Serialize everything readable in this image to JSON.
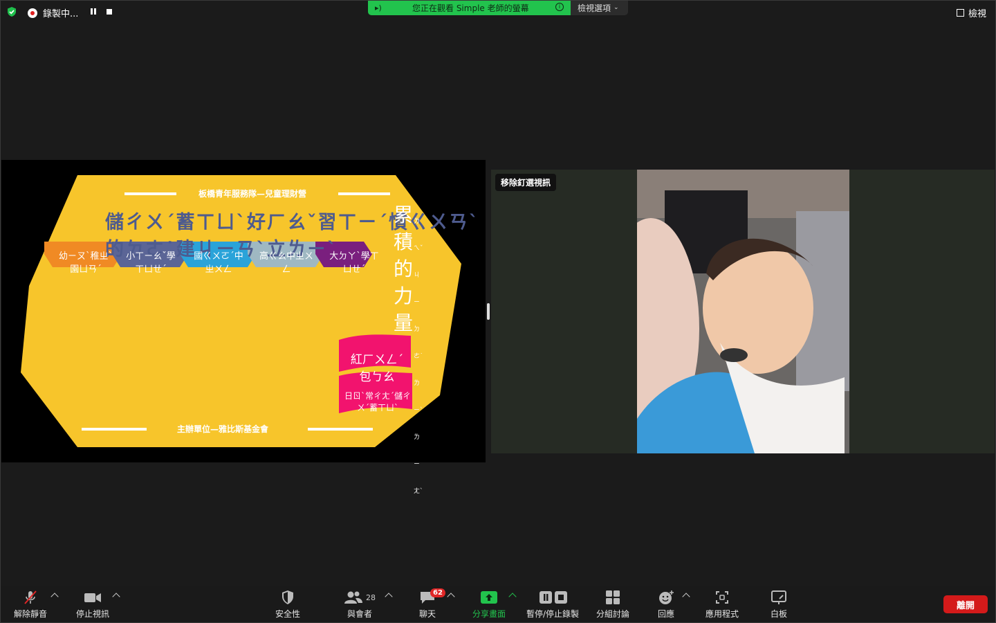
{
  "topbar": {
    "recording_label": "錄製中...",
    "share_banner": "您正在觀看 Simple 老師的螢幕",
    "view_options": "檢視選項",
    "view_label": "檢視"
  },
  "slide": {
    "top_caption": "板橋青年服務隊—兒童理財營",
    "title": "儲ㄔㄨˊ蓄ㄒㄩˋ好ㄏㄠˇ習ㄒㄧˊ慣ㄍㄨㄢˋ的ㄉㄜ˙建ㄐㄧㄢˋ立ㄌㄧˋ",
    "stages": [
      "幼ㄧㄡˋ稚ㄓˋ園ㄩㄢˊ",
      "小ㄒㄧㄠˇ學ㄒㄩㄝˊ",
      "國ㄍㄨㄛˊ中ㄓㄨㄥ",
      "高ㄍㄠ中ㄓㄨㄥ",
      "大ㄉㄚˋ學ㄒㄩㄝˊ"
    ],
    "stage_colors": [
      "#f08a24",
      "#5b6596",
      "#2aa3d9",
      "#9fb8c2",
      "#7a1f7e"
    ],
    "vertical_title": [
      "累",
      "積",
      "的",
      "力",
      "量"
    ],
    "vertical_zhuyin": [
      "ㄌㄟˇ",
      "ㄐㄧ",
      "ㄉㄜ˙",
      "ㄌㄧˋ",
      "ㄌㄧㄤˋ"
    ],
    "flag1": "紅ㄏㄨㄥˊ包ㄅㄠ",
    "flag2": "日ㄖˋ常ㄔㄤˊ儲ㄔㄨˊ蓄ㄒㄩˋ",
    "bottom_caption": "主辦單位—雅比斯基金會",
    "bg_color": "#f7c52b"
  },
  "video": {
    "unpin_label": "移除釘選視訊"
  },
  "toolbar": {
    "unmute": "解除靜音",
    "stop_video": "停止視訊",
    "security": "安全性",
    "participants": "與會者",
    "participants_count": "28",
    "chat": "聊天",
    "chat_badge": "62",
    "share_screen": "分享畫面",
    "pause_stop_record": "暫停/停止錄製",
    "breakout": "分組討論",
    "reactions": "回應",
    "apps": "應用程式",
    "whiteboard": "白板",
    "leave": "離開"
  }
}
